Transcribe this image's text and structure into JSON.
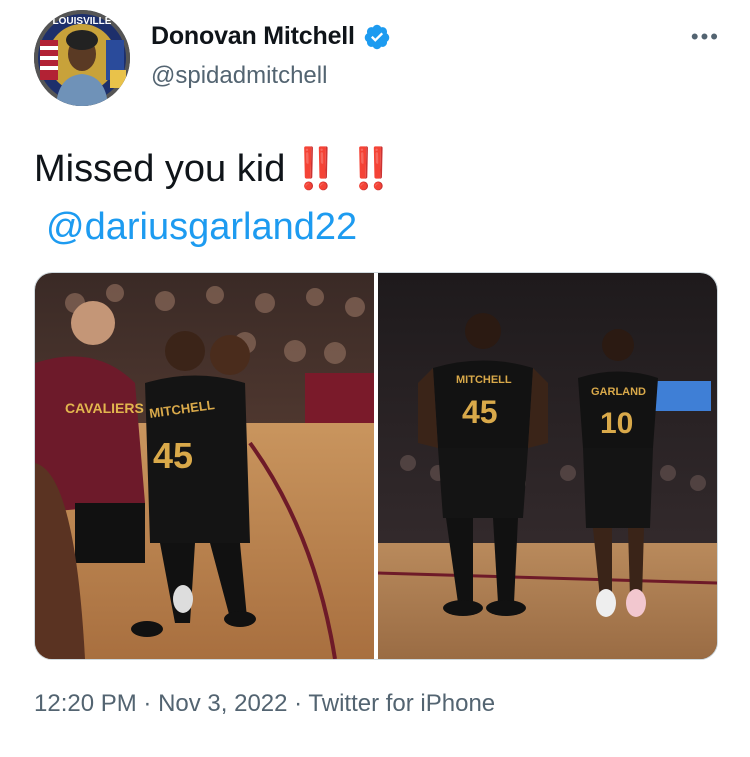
{
  "user": {
    "display_name": "Donovan Mitchell",
    "handle": "@spidadmitchell",
    "verified": true,
    "verified_color": "#1d9bf0",
    "avatar_badge_text": "LOUISVILLE"
  },
  "menu": {
    "more_icon": "more-horizontal-icon",
    "more_glyph": "•••"
  },
  "tweet": {
    "text": "Missed you kid",
    "emoji": "‼️ ‼️",
    "mention": "@dariusgarland22"
  },
  "media": {
    "photo_1": {
      "jersey_text": "MITCHELL",
      "jersey_number": "45",
      "shirt_text": "CAVALIERS"
    },
    "photo_2": {
      "player_1_name": "MITCHELL",
      "player_1_number": "45",
      "player_2_name": "GARLAND",
      "player_2_number": "10"
    }
  },
  "meta": {
    "time": "12:20 PM",
    "date": "Nov 3, 2022",
    "source": "Twitter for iPhone"
  }
}
